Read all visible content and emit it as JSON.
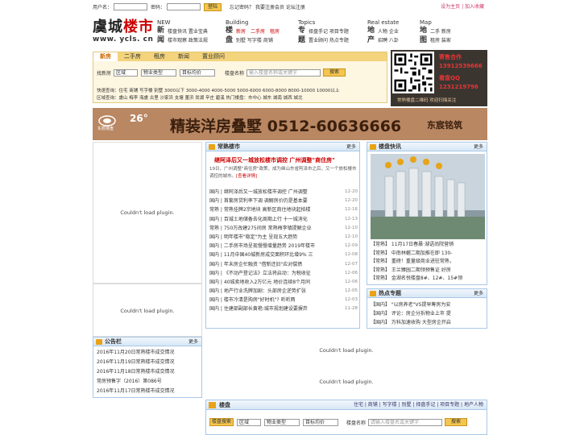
{
  "topbar": {
    "user_label": "用户名：",
    "pass_label": "密码：",
    "login_button": "登陆",
    "links": "忘记密码？ 我要注册会员 论坛注册",
    "right": "设为主页 | 加入收藏"
  },
  "logo": {
    "cn_a": "虞城",
    "cn_b": "楼市",
    "url": "www. ycls. cn"
  },
  "nav": [
    {
      "en": "NEW",
      "big": "新闻",
      "line1": "楼盘快讯  置业宝典",
      "line2": "楼市观察  政策法规"
    },
    {
      "en": "Building",
      "big": "楼盘",
      "line1a": "新房",
      "line1b": "二手房",
      "line1c": "租房",
      "line2": "别墅  写字楼  商铺"
    },
    {
      "en": "Topics",
      "big": "专题",
      "line1": "择盘手记  项目专题",
      "line2": "置业顾问  热点专题"
    },
    {
      "en": "Real estate",
      "big": "地产",
      "line1": "人物  企业",
      "line2": "招聘  八卦"
    },
    {
      "en": "Map",
      "big": "地图",
      "line1": "二手  新房",
      "line2": "租房  装家"
    }
  ],
  "search": {
    "tabs": [
      "新房",
      "二手房",
      "租房",
      "新闻",
      "置业顾问"
    ],
    "label_find": "找新房",
    "sel_area": "区域",
    "sel_type": "物业类型",
    "sel_price": "目标均价",
    "label_name": "楼盘名称",
    "keyword_placeholder": "输入楼盘名称或关键字",
    "search_button": "搜索",
    "quick": "快速查询：住宅 商铺 写字楼 别墅 3000以下 3000-4000 4000-5000 5000-6000 6000-8000 8000-10000 10000以上",
    "area": "区域查询：虞山 梅李 海虞 古里 沙家浜 支塘 董浜 尚湖 辛庄 碧溪     热门楼盘：市中心 城东 城南 城西 城北"
  },
  "adtop": {
    "t1": "寄售合作",
    "t2": "13912539666",
    "t3": "看盘QQ",
    "t4": "1231219796",
    "t5": "常熟楼盘二维码 欢迎扫描关注"
  },
  "banner": {
    "brand": "东宸楼盘",
    "num": "26°",
    "headline": "精装洋房叠墅 0512-60636666",
    "right": "东宸铭筑"
  },
  "plugin_msg": "Couldn't load plugin.",
  "news": {
    "title": "常熟楼市",
    "more": "更多",
    "head": "继阿泽后又一城放松楼市调控 广州调整\"商住房\"",
    "summary": "19日，广州调整\"商住房\"政策，成为继山东省阿泽市之后，又一个放松楼市调控的城市。",
    "detail_link": "[查看详情]",
    "items": [
      {
        "t": "国内 | 继阿泽后又一城放松楼市调控 广州调整",
        "d": "12-20"
      },
      {
        "t": "国内 | 首套房贷利率下调 调解房价仍是基本要",
        "d": "12-20"
      },
      {
        "t": "常熟 | 常熟挂牌2宗地块 高新区商住地块起拍楼",
        "d": "12-16"
      },
      {
        "t": "国内 | 百城土地储备去化周期上行 十一城消化",
        "d": "12-13"
      },
      {
        "t": "常熟 | 750万改建275间房 常熟梅李镇提解企业",
        "d": "12-10"
      },
      {
        "t": "国内 | 明年楼市\"稳定\"为主 呈现五大趋势",
        "d": "12-10"
      },
      {
        "t": "国内 | 二手房市场呈现慢慢增量趋势 2019年楼市",
        "d": "12-09"
      },
      {
        "t": "国内 | 11月中国40城新房成交面积环比增9% 三",
        "d": "12-08"
      },
      {
        "t": "国内 | 年末房企忙融资 \"借新还旧\"应对偿债",
        "d": "12-07"
      },
      {
        "t": "国内 | 《不动产登记法》立法将启动：为税收征",
        "d": "12-06"
      },
      {
        "t": "国内 | 40城卖地收入2万亿元 地价连续8个月同",
        "d": "12-06"
      },
      {
        "t": "国内 | 地产行业洗牌加剧：头部房企逆势扩张",
        "d": "12-05"
      },
      {
        "t": "国内 | 楼市冷清是购房\"好时机\"? 听听两",
        "d": "12-03"
      },
      {
        "t": "国内 | 住建部副部长黄艳:城市规划建设要摒弃",
        "d": "11-28"
      }
    ]
  },
  "building": {
    "title": "楼盘快讯",
    "more": "更多",
    "items": [
      "【常熟】 11月17日春晨·湖语尚院营销",
      "【常熟】 中南林樾二期加推在即 130-",
      "【常熟】 重磅！重量级商业进驻常熟，",
      "【常熟】 王兰臻园二期领预售证 好房",
      "【常熟】 金湖名悦楼盘8#、12#、15#领"
    ]
  },
  "hot": {
    "title": "热点专题",
    "more": "更多",
    "items": [
      "【国内】 \"以房养老\"VS提早筹房为安",
      "【国内】 评论：房企分拆物业上市 提",
      "【国内】 万科加速收购 大型房企开启"
    ]
  },
  "notice": {
    "title": "公告栏",
    "more": "更多",
    "items": [
      "2016年11月20日常熟楼市成交情况",
      "2016年11月19日常熟楼市成交情况",
      "2016年11月18日常熟楼市成交情况",
      "常房预售字（2016）第086号",
      "2016年11月17日常熟楼市成交情况"
    ]
  },
  "lp": {
    "title": "楼盘",
    "links": "住宅 | 商铺 | 写字楼 | 别墅 | 择盘手记 | 项目专题 | 地产人物",
    "tag": "楼盘搜索",
    "sel_area": "区域",
    "sel_type": "物业类型",
    "sel_price": "目标均价",
    "label_name": "楼盘名称",
    "keyword_placeholder": "请输入楼盘名或关键字",
    "search_button": "搜索"
  }
}
